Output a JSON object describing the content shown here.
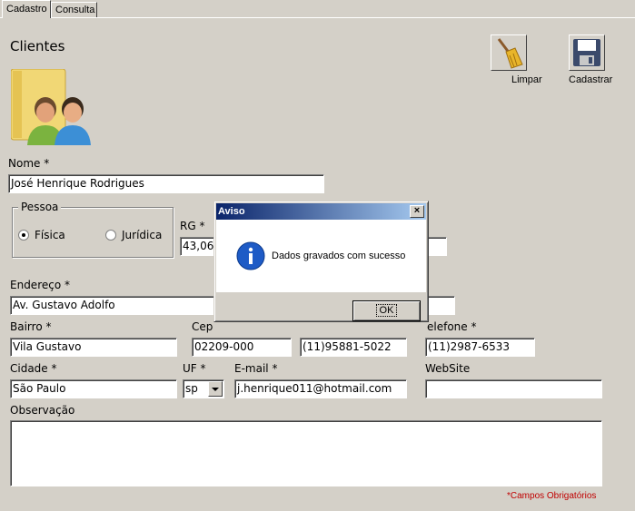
{
  "tabs": [
    {
      "label": "Cadastro"
    },
    {
      "label": "Consulta"
    }
  ],
  "page_title": "Clientes",
  "toolbar": {
    "clear_label": "Limpar",
    "save_label": "Cadastrar"
  },
  "form": {
    "nome": {
      "label": "Nome *",
      "value": "José Henrique Rodrigues"
    },
    "pessoa": {
      "legend": "Pessoa",
      "options": [
        {
          "label": "Física",
          "selected": true
        },
        {
          "label": "Jurídica",
          "selected": false
        }
      ]
    },
    "rg": {
      "label": "RG *",
      "value": "43,06"
    },
    "endereco": {
      "label": "Endereço *",
      "value": "Av. Gustavo Adolfo"
    },
    "bairro": {
      "label": "Bairro *",
      "value": "Vila Gustavo"
    },
    "cep": {
      "label": "Cep",
      "value": "02209-000"
    },
    "celular": {
      "value": "(11)95881-5022"
    },
    "telefone": {
      "label": "elefone *",
      "value": "(11)2987-6533"
    },
    "cidade": {
      "label": "Cidade *",
      "value": "São Paulo"
    },
    "uf": {
      "label": "UF *",
      "value": "sp"
    },
    "email": {
      "label": "E-mail *",
      "value": "j.henrique011@hotmail.com"
    },
    "website": {
      "label": "WebSite",
      "value": ""
    },
    "observacao": {
      "label": "Observação",
      "value": ""
    },
    "required_note": "*Campos Obrigatórios"
  },
  "dialog": {
    "title": "Aviso",
    "close": "×",
    "message": "Dados gravados com sucesso",
    "ok_label": "OK"
  },
  "colors": {
    "window_bg": "#d4d0c8",
    "title_bar": "#0a246a",
    "required_note": "#c00000",
    "info_icon": "#1e5bc6"
  }
}
